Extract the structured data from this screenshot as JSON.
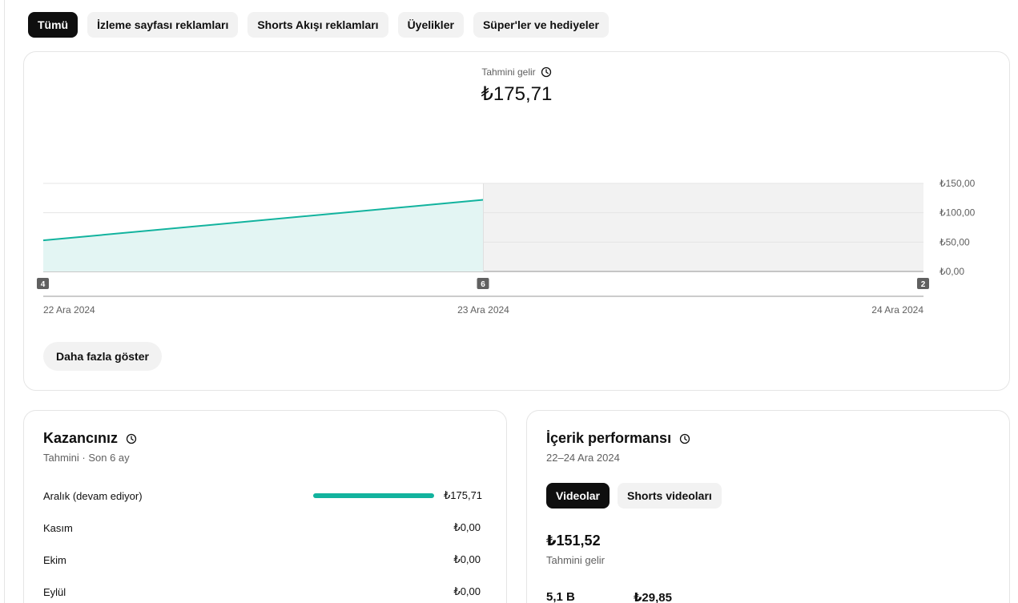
{
  "filters": [
    "Tümü",
    "İzleme sayfası reklamları",
    "Shorts Akışı reklamları",
    "Üyelikler",
    "Süper'ler ve hediyeler"
  ],
  "revenue": {
    "title": "Tahmini gelir",
    "value": "₺175,71",
    "more_button": "Daha fazla göster"
  },
  "chart_data": {
    "type": "area",
    "x": [
      "22 Ara 2024",
      "23 Ara 2024",
      "24 Ara 2024"
    ],
    "series": [
      {
        "values": [
          53,
          122
        ]
      }
    ],
    "y_ticks": [
      "₺150,00",
      "₺100,00",
      "₺50,00",
      "₺0,00"
    ],
    "ylim": [
      0,
      150
    ],
    "markers": [
      {
        "label": "4",
        "x": "22 Ara 2024"
      },
      {
        "label": "6",
        "x": "23 Ara 2024"
      },
      {
        "label": "2",
        "x": "24 Ara 2024"
      }
    ],
    "grid": true,
    "line_color": "#12b39e",
    "fill_color": "#e3f5f3",
    "pending_region_color": "#f2f2f2"
  },
  "earnings": {
    "title": "Kazancınız",
    "subtitle": "Tahmini · Son 6 ay",
    "rows": [
      {
        "label": "Aralık (devam ediyor)",
        "value": "₺175,71",
        "share": 1
      },
      {
        "label": "Kasım",
        "value": "₺0,00",
        "share": 0
      },
      {
        "label": "Ekim",
        "value": "₺0,00",
        "share": 0
      },
      {
        "label": "Eylül",
        "value": "₺0,00",
        "share": 0
      }
    ]
  },
  "performance": {
    "title": "İçerik performansı",
    "subtitle": "22–24 Ara 2024",
    "tabs": [
      "Videolar",
      "Shorts videoları"
    ],
    "value": "₺151,52",
    "value_label": "Tahmini gelir",
    "stats": [
      "5,1 B",
      "₺29,85"
    ]
  },
  "colors": {
    "accent": "#12b39e",
    "chip_active": "#0f0f0f"
  }
}
